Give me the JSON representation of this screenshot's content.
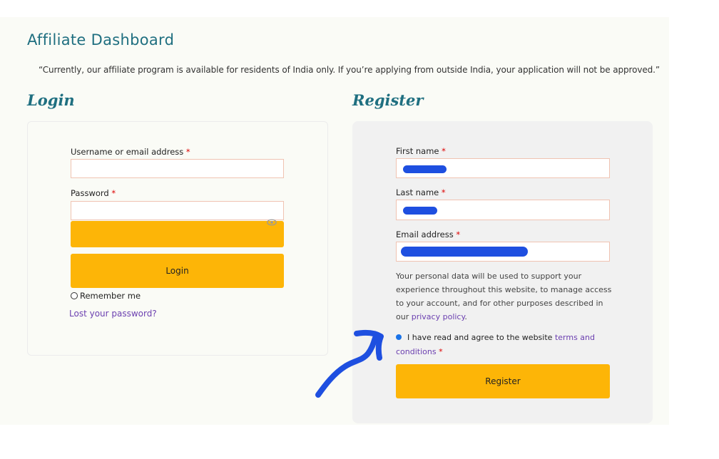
{
  "page": {
    "title": "Affiliate Dashboard",
    "notice": "“Currently, our affiliate program is available for residents of India only. If you’re applying from outside India, your application will not be approved.”"
  },
  "login": {
    "heading": "Login",
    "username_label": "Username or email address",
    "password_label": "Password",
    "required_marker": "*",
    "username_value": "",
    "password_value": "",
    "submit_label": "Login",
    "remember_label": "Remember me",
    "lost_password_link": "Lost your password?"
  },
  "register": {
    "heading": "Register",
    "first_name_label": "First name",
    "last_name_label": "Last name",
    "email_label": "Email address",
    "required_marker": "*",
    "privacy_text": "Your personal data will be used to support your experience throughout this website, to manage access to your account, and for other purposes described in our",
    "privacy_link": "privacy policy",
    "privacy_end": ".",
    "agree_text": "I have read and agree to the website",
    "terms_link": "terms and conditions",
    "agree_checked": true,
    "submit_label": "Register"
  },
  "colors": {
    "accent": "#fdb507",
    "heading": "#1f6f80",
    "link": "#6b3fb0",
    "annotation": "#1e4fe0"
  }
}
